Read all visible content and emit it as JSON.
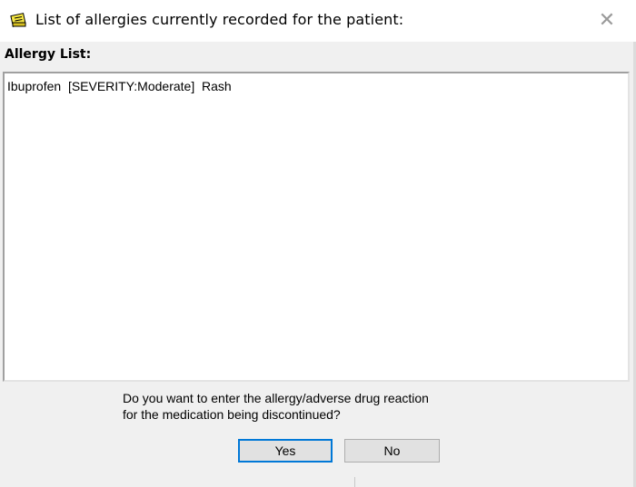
{
  "window": {
    "title": "List of allergies currently recorded for the patient:",
    "icon": "note-icon",
    "close_glyph": "✕"
  },
  "allergy_list": {
    "label": "Allergy List:",
    "items": [
      "Ibuprofen  [SEVERITY:Moderate]  Rash"
    ]
  },
  "prompt": {
    "line1": "Do you want to enter the allergy/adverse drug reaction",
    "line2": "for the medication being discontinued?"
  },
  "buttons": {
    "yes_label": "Yes",
    "no_label": "No"
  },
  "colors": {
    "dialog_background": "#f0f0f0",
    "titlebar_background": "#ffffff",
    "default_button_border": "#0078d7",
    "icon_yellow": "#f5e642"
  }
}
